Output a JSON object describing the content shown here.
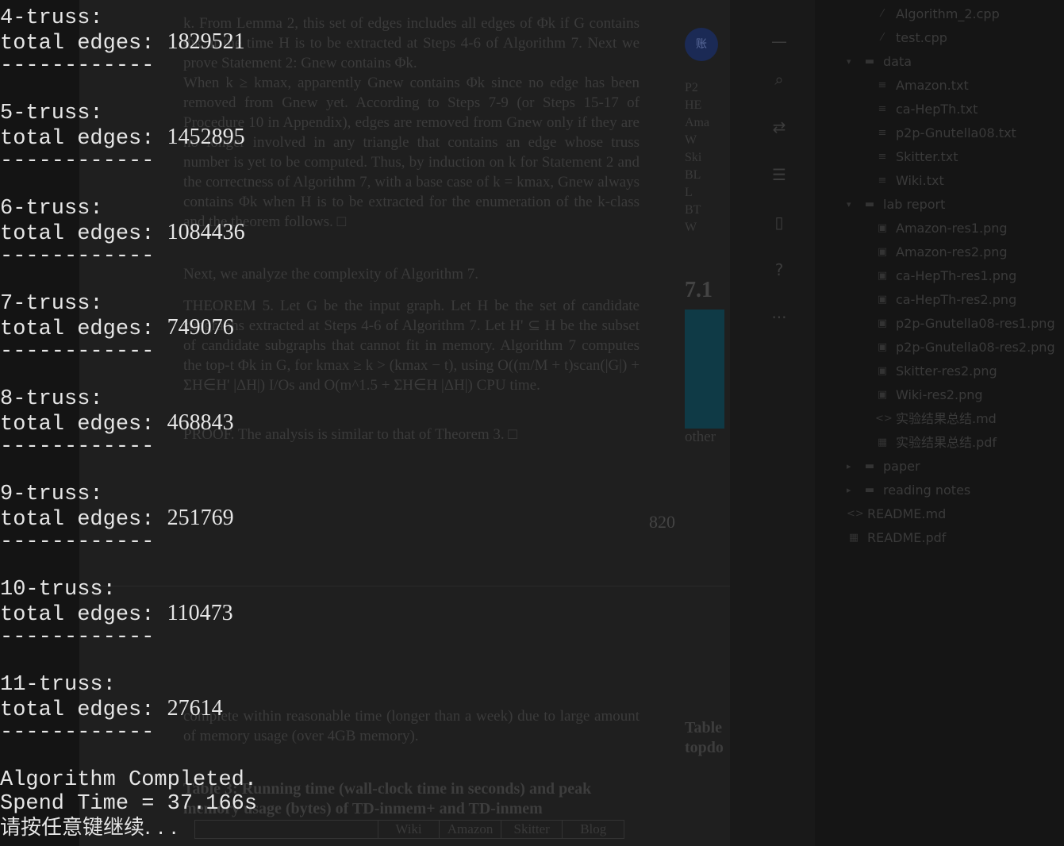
{
  "console": {
    "blocks": [
      {
        "heading": "4-truss:",
        "label": "total edges: ",
        "value": "1829521",
        "separator": "------------"
      },
      {
        "heading": "5-truss:",
        "label": "total edges: ",
        "value": "1452895",
        "separator": "------------"
      },
      {
        "heading": "6-truss:",
        "label": "total edges: ",
        "value": "1084436",
        "separator": "------------"
      },
      {
        "heading": "7-truss:",
        "label": "total edges: ",
        "value": "749076",
        "separator": "------------"
      },
      {
        "heading": "8-truss:",
        "label": "total edges: ",
        "value": "468843",
        "separator": "------------"
      },
      {
        "heading": "9-truss:",
        "label": "total edges: ",
        "value": "251769",
        "separator": "------------"
      },
      {
        "heading": "10-truss:",
        "label": "total edges: ",
        "value": "110473",
        "separator": "------------"
      },
      {
        "heading": "11-truss:",
        "label": "total edges: ",
        "value": "27614",
        "separator": "------------"
      }
    ],
    "completed": "Algorithm Completed.",
    "spend_time": "Spend Time = 37.166s",
    "prompt": "请按任意键继续. . ."
  },
  "pdf": {
    "paragraph1": "k. From Lemma 2, this set of edges includes all edges of Φk if G contains Φk at the time H is to be extracted at Steps 4-6 of Algorithm 7. Next we prove Statement 2: Gnew contains Φk.",
    "paragraph2": "When k ≥ kmax, apparently Gnew contains Φk since no edge has been removed from Gnew yet. According to Steps 7-9 (or Steps 15-17 of Procedure 10 in Appendix), edges are removed from Gnew only if they are no longer involved in any triangle that contains an edge whose truss number is yet to be computed. Thus, by induction on k for Statement 2 and the correctness of Algorithm 7, with a base case of k = kmax, Gnew always contains Φk when H is to be extracted for the enumeration of the k-class and the theorem follows. □",
    "paragraph3": "Next, we analyze the complexity of Algorithm 7.",
    "paragraph4": "THEOREM 5. Let G be the input graph. Let H be the set of candidate subgraphs extracted at Steps 4-6 of Algorithm 7. Let H' ⊆ H be the subset of candidate subgraphs that cannot fit in memory. Algorithm 7 computes the top-t Φk in G, for kmax ≥ k > (kmax − t), using O((m/M + t)scan(|G|) + ΣH∈H' |ΔH|) I/Os and O(m^1.5 + ΣH∈H |ΔH|) CPU time.",
    "paragraph5": "PROOF. The analysis is similar to that of Theorem 3. □",
    "page_number": "820",
    "paragraph6": "complete within reasonable time (longer than a week) due to large amount of memory usage (over 4GB memory).",
    "table_caption": "Table 3: Running time (wall-clock time in seconds) and peak memory usage (bytes) of TD-inmem+ and TD-inmem",
    "table_headers": [
      "",
      "Wiki",
      "Amazon",
      "Skitter",
      "Blog"
    ],
    "side_labels": [
      "P2",
      "HE",
      "Ama",
      "W",
      "Ski",
      "BL",
      "L",
      "BT",
      "W"
    ],
    "section_number": "7.1",
    "side_caption": "Table topdo",
    "side_other": "other"
  },
  "explorer": {
    "items": [
      {
        "label": "Algorithm_2.cpp",
        "icon": "cpp-file-icon",
        "depth": 2
      },
      {
        "label": "test.cpp",
        "icon": "cpp-file-icon",
        "depth": 2
      },
      {
        "label": "data",
        "icon": "folder-icon",
        "depth": 1,
        "expanded": true
      },
      {
        "label": "Amazon.txt",
        "icon": "text-file-icon",
        "depth": 2
      },
      {
        "label": "ca-HepTh.txt",
        "icon": "text-file-icon",
        "depth": 2
      },
      {
        "label": "p2p-Gnutella08.txt",
        "icon": "text-file-icon",
        "depth": 2
      },
      {
        "label": "Skitter.txt",
        "icon": "text-file-icon",
        "depth": 2
      },
      {
        "label": "Wiki.txt",
        "icon": "text-file-icon",
        "depth": 2
      },
      {
        "label": "lab report",
        "icon": "folder-icon",
        "depth": 1,
        "expanded": true
      },
      {
        "label": "Amazon-res1.png",
        "icon": "image-file-icon",
        "depth": 2
      },
      {
        "label": "Amazon-res2.png",
        "icon": "image-file-icon",
        "depth": 2
      },
      {
        "label": "ca-HepTh-res1.png",
        "icon": "image-file-icon",
        "depth": 2
      },
      {
        "label": "ca-HepTh-res2.png",
        "icon": "image-file-icon",
        "depth": 2
      },
      {
        "label": "p2p-Gnutella08-res1.png",
        "icon": "image-file-icon",
        "depth": 2
      },
      {
        "label": "p2p-Gnutella08-res2.png",
        "icon": "image-file-icon",
        "depth": 2
      },
      {
        "label": "Skitter-res2.png",
        "icon": "image-file-icon",
        "depth": 2
      },
      {
        "label": "Wiki-res2.png",
        "icon": "image-file-icon",
        "depth": 2
      },
      {
        "label": "实验结果总结.md",
        "icon": "markdown-file-icon",
        "depth": 2
      },
      {
        "label": "实验结果总结.pdf",
        "icon": "pdf-file-icon",
        "depth": 2
      },
      {
        "label": "paper",
        "icon": "folder-icon",
        "depth": 1,
        "expanded": false
      },
      {
        "label": "reading notes",
        "icon": "folder-icon",
        "depth": 1,
        "expanded": false
      },
      {
        "label": "README.md",
        "icon": "markdown-file-icon",
        "depth": 1
      },
      {
        "label": "README.pdf",
        "icon": "pdf-file-icon",
        "depth": 1
      }
    ]
  },
  "sidebar_icons": [
    "minus-icon",
    "search-icon",
    "translate-icon",
    "sliders-icon",
    "book-icon",
    "help-icon",
    "more-icon"
  ],
  "avatar_text": "账"
}
